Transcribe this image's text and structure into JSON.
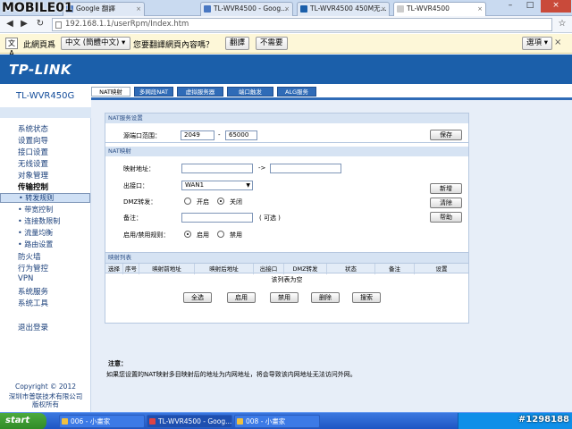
{
  "watermark": "MOBILE01",
  "watermark_id": "#1298188",
  "browser": {
    "tabs": [
      {
        "label": "Google 翻譯"
      },
      {
        "label": "TL-WVR4500 - Goog..."
      },
      {
        "label": "TL-WVR4500 450M无..."
      },
      {
        "label": "TL-WVR4500"
      }
    ],
    "url": "192.168.1.1/userRpm/Index.htm",
    "translate_bar": {
      "prefix": "此網頁爲",
      "lang": "中文 (簡體中文)",
      "question": "您要翻譯網頁內容嗎？",
      "translate_btn": "翻譯",
      "no_btn": "不需要",
      "options_btn": "選項"
    }
  },
  "brand": {
    "logo": "TP-LINK",
    "model": "TL-WVR450G"
  },
  "top_menu": [
    {
      "label": "NAT映射"
    },
    {
      "label": "多网段NAT"
    },
    {
      "label": "虚拟服务器"
    },
    {
      "label": "端口触发"
    },
    {
      "label": "ALG服务"
    }
  ],
  "sidebar": {
    "items": [
      {
        "label": "系统状态"
      },
      {
        "label": "设置向导"
      },
      {
        "label": "接口设置"
      },
      {
        "label": "无线设置"
      },
      {
        "label": "对象管理"
      },
      {
        "label": "传输控制"
      },
      {
        "label": "• 转发规则"
      },
      {
        "label": "• 带宽控制"
      },
      {
        "label": "• 连接数限制"
      },
      {
        "label": "• 流量均衡"
      },
      {
        "label": "• 路由设置"
      },
      {
        "label": "防火墙"
      },
      {
        "label": "行为管控"
      },
      {
        "label": "VPN"
      },
      {
        "label": "系统服务"
      },
      {
        "label": "系统工具"
      },
      {
        "label": "退出登录"
      }
    ],
    "copyright": "Copyright © 2012",
    "company": "深圳市普联技术有限公司",
    "rights": "版权所有"
  },
  "nat_service": {
    "header": "NAT服务设置",
    "port_range_label": "源端口范围：",
    "port_from": "2049",
    "dash": "-",
    "port_to": "65000",
    "save": "保存"
  },
  "nat_map": {
    "header": "NAT映射",
    "map_addr_label": "映射地址：",
    "arrow": "->",
    "out_if_label": "出接口：",
    "out_if_value": "WAN1",
    "dmz_label": "DMZ转发：",
    "dmz_on": "开启",
    "dmz_off": "关闭",
    "note_label": "备注：",
    "optional": "( 可选 )",
    "rule_label": "启用/禁用规则：",
    "enable": "启用",
    "disable": "禁用",
    "add": "新增",
    "clear": "清除",
    "help": "帮助"
  },
  "map_list": {
    "header": "映射列表",
    "columns": [
      "选择",
      "序号",
      "映射前地址",
      "映射后地址",
      "出接口",
      "DMZ转发",
      "状态",
      "备注",
      "设置"
    ],
    "empty": "该列表为空",
    "buttons": {
      "select_all": "全选",
      "enable": "启用",
      "disable": "禁用",
      "delete": "删除",
      "search": "搜索"
    }
  },
  "note": {
    "title": "注意：",
    "text": "如果您设置的NAT映射多目映射后的地址为内网地址，将会导致该内网地址无法访问外网。"
  },
  "taskbar": {
    "start": "start",
    "buttons": [
      {
        "label": "006 - 小畫家"
      },
      {
        "label": "TL-WVR4500 - Goog..."
      },
      {
        "label": "008 - 小畫家"
      }
    ]
  }
}
